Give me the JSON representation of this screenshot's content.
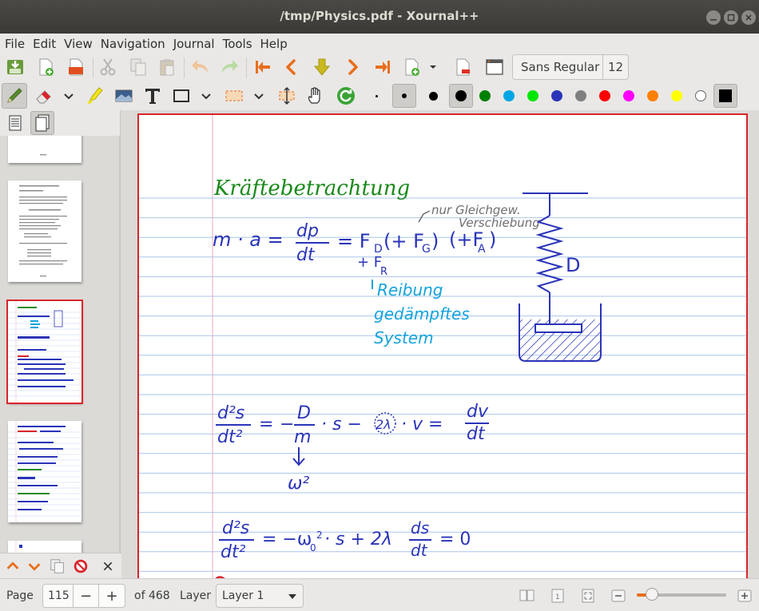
{
  "window": {
    "title": "/tmp/Physics.pdf - Xournal++"
  },
  "menu": [
    "File",
    "Edit",
    "View",
    "Navigation",
    "Journal",
    "Tools",
    "Help"
  ],
  "toolbar": {
    "font_name": "Sans Regular",
    "font_size": "12"
  },
  "colors": {
    "accent": "#d9242a",
    "ink_green": "#1a8a1a",
    "ink_blue": "#2a34b8",
    "ink_cyan": "#14a3dc",
    "ink_gray": "#6e6e6e",
    "ruling": "#a9c6ea",
    "margin": "#e8a7c7",
    "palette": [
      "#000000",
      "#008000",
      "#00a5e6",
      "#00e600",
      "#2a34b8",
      "#7f7f7f",
      "#ff0000",
      "#ff00ff",
      "#ff8000",
      "#ffff00",
      "#ffffff",
      "#000000"
    ]
  },
  "status": {
    "page_label": "Page",
    "page_value": "115",
    "page_total": "of 468",
    "layer_label": "Layer",
    "layer_value": "Layer 1",
    "zoom_fraction": 0.17
  },
  "page_content": {
    "heading": "Kräftebetrachtung",
    "eq1": "m · a =",
    "eq1_rhs": "= F",
    "sub_D": "D",
    "sub_G": "G",
    "sub_A": "A",
    "sub_R": "R",
    "plus_FR": "+ F",
    "annotation1": "nur Gleichgew.",
    "annotation2": "Verschiebung",
    "spring_label": "D",
    "reibung": "Reibung",
    "gedaempftes": "gedämpftes",
    "system": "System",
    "omega_sq": "ω²",
    "eq3_rhs": "= 0"
  },
  "icons": {
    "toolbar1": [
      "save-icon",
      "new-page-icon",
      "export-pdf-icon",
      "cut-icon",
      "copy-icon",
      "paste-icon",
      "undo-icon",
      "redo-icon",
      "first-page-icon",
      "previous-page-icon",
      "goto-page-icon",
      "next-page-icon",
      "last-page-icon",
      "insert-page-icon",
      "delete-page-icon",
      "fullscreen-icon"
    ],
    "toolbar2": [
      "pen-icon",
      "eraser-icon",
      "highlighter-icon",
      "image-icon",
      "text-icon",
      "shape-icon",
      "select-rect-icon",
      "vertical-space-icon",
      "hand-icon",
      "refresh-icon"
    ]
  }
}
